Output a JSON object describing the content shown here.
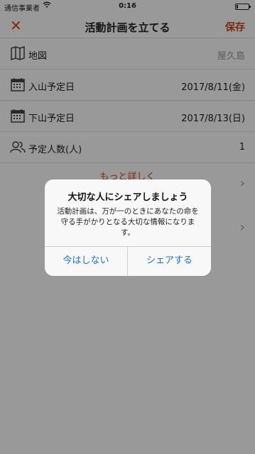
{
  "status_bar": {
    "carrier": "通信事業者",
    "time": "0:16"
  },
  "nav": {
    "title": "活動計画を立てる",
    "save_label": "保存"
  },
  "rows": [
    {
      "label": "地図",
      "value": "屋久島",
      "icon": "map-icon"
    },
    {
      "label": "入山予定日",
      "value": "2017/8/11(金)",
      "icon": "calendar-icon"
    },
    {
      "label": "下山予定日",
      "value": "2017/8/13(日)",
      "icon": "calendar-icon"
    },
    {
      "label": "予定人数(人)",
      "value": "1",
      "icon": "people-icon"
    }
  ],
  "more_link": "もっと詳しく",
  "dialog": {
    "title": "大切な人にシェアしましょう",
    "message": "活動計画は、万が一のときにあなたの命を守る手がかりとなる大切な情報になります。",
    "cancel_label": "今はしない",
    "share_label": "シェアする"
  },
  "colors": {
    "accent": "#d2461b",
    "link_blue": "#1a72d6"
  }
}
